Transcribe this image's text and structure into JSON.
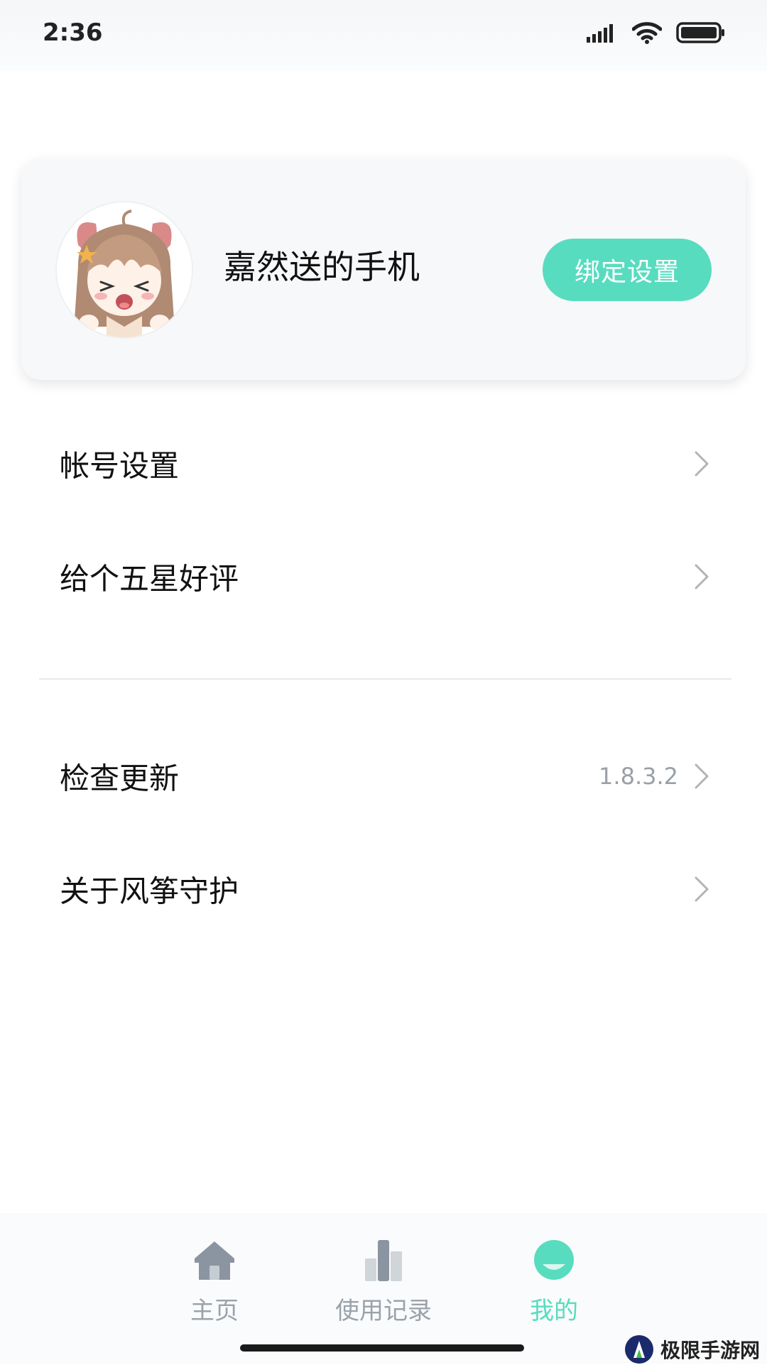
{
  "status_bar": {
    "time": "2:36",
    "icons": [
      "signal-icon",
      "wifi-icon",
      "battery-icon"
    ]
  },
  "profile": {
    "name": "嘉然送的手机",
    "bind_button_label": "绑定设置",
    "avatar": "avatar-anime-girl"
  },
  "menu": {
    "items": [
      {
        "label": "帐号设置"
      },
      {
        "label": "给个五星好评"
      },
      {
        "label": "检查更新",
        "value": "1.8.3.2"
      },
      {
        "label": "关于风筝守护"
      }
    ]
  },
  "bottom_nav": {
    "tabs": [
      {
        "label": "主页",
        "icon": "home-icon",
        "active": false
      },
      {
        "label": "使用记录",
        "icon": "bar-chart-icon",
        "active": false
      },
      {
        "label": "我的",
        "icon": "profile-icon",
        "active": true
      }
    ]
  },
  "watermark": {
    "text": "极限手游网"
  },
  "colors": {
    "accent": "#58dcbf",
    "inactive": "#9aa2aa",
    "card_bg": "#f7f8fa"
  }
}
